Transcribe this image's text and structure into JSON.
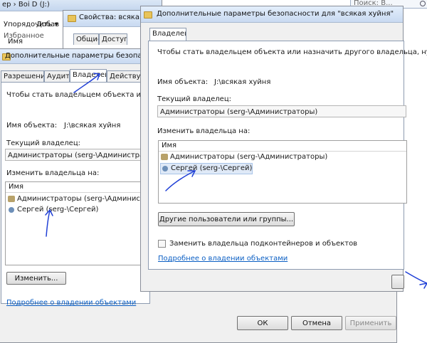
{
  "explorer": {
    "breadcrumb": "ер › Boi D (J:)",
    "search_placeholder": "Поиск: В...",
    "menu_item": "Упорядочить ▾",
    "menu_item2": "Добав",
    "column_header": "Имя",
    "tree_item": "Избранное"
  },
  "props_window": {
    "title": "Свойства: всякая",
    "tabs": [
      "Общие",
      "Доступ"
    ]
  },
  "back_dialog": {
    "title": "Дополнительные параметры безопасн",
    "tabs": [
      "Разрешения",
      "Аудит",
      "Владелец",
      "Действу"
    ],
    "instruction": "Чтобы стать владельцем объекта или наз",
    "object_label": "Имя объекта:",
    "object_value": "J:\\всякая хуйня",
    "current_owner_label": "Текущий владелец:",
    "current_owner_value": "Администраторы (serg-\\Администраторы)",
    "change_owner_label": "Изменить владельца на:",
    "list_header": "Имя",
    "owners": [
      "Администраторы (serg-\\Администрат",
      "Сергей (serg-\\Сергей)"
    ],
    "change_button": "Изменить...",
    "learn_more_link": "Подробнее о владении объектами",
    "ok_button": "ОК",
    "cancel_button": "Отмена",
    "apply_button": "Применить"
  },
  "front_dialog": {
    "title": "Дополнительные параметры безопасности  для \"всякая хуйня\"",
    "tab": "Владелец",
    "instruction": "Чтобы стать владельцем объекта или назначить другого владельца, нужн",
    "object_label": "Имя объекта:",
    "object_value": "J:\\всякая хуйня",
    "current_owner_label": "Текущий владелец:",
    "current_owner_value": "Администраторы (serg-\\Администраторы)",
    "change_owner_label": "Изменить владельца на:",
    "list_header": "Имя",
    "owners": [
      "Администраторы (serg-\\Администраторы)",
      "Сергей (serg-\\Сергей)"
    ],
    "other_users_button": "Другие пользователи или группы...",
    "replace_checkbox_label": "Заменить владельца подконтейнеров и объектов",
    "replace_checked": false,
    "learn_more_link": "Подробнее о владении объектами"
  },
  "colors": {
    "annotation": "#1f3fd6",
    "link": "#0b5fc4",
    "selection": "#dfe9f7"
  }
}
